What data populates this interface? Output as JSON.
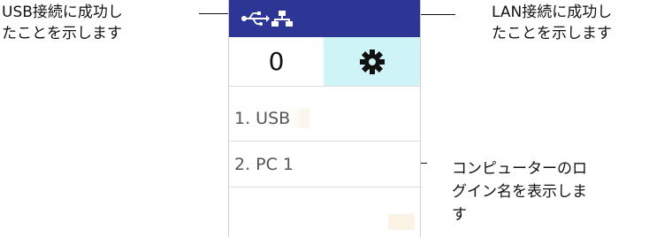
{
  "callouts": {
    "usb": {
      "line1": "USB接続に成功し",
      "line2": "たことを示します"
    },
    "lan": {
      "line1": "LAN接続に成功し",
      "line2": "たことを示します"
    },
    "login": {
      "line1": "コンピューターのロ",
      "line2": "グイン名を表示しま",
      "line3": "す"
    }
  },
  "screen": {
    "statusbar": {
      "background": "#2d3694",
      "icons": [
        "usb-icon",
        "lan-network-icon"
      ]
    },
    "counter": {
      "value": "0"
    },
    "settings": {
      "icon": "gear-icon",
      "background": "#cff4f7"
    },
    "list": [
      {
        "label": "1. USB"
      },
      {
        "label": "2. PC 1"
      },
      {
        "label": ""
      }
    ]
  }
}
